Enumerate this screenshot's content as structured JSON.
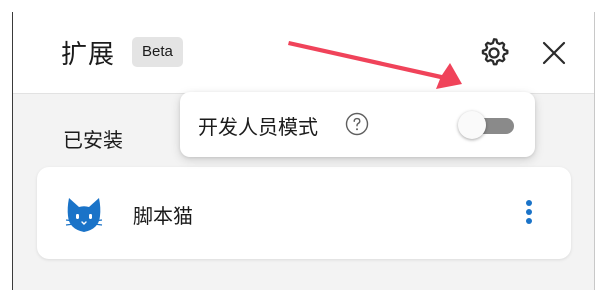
{
  "header": {
    "title": "扩展",
    "badge": "Beta",
    "settings_icon": "gear-icon",
    "close_icon": "close-icon"
  },
  "installed": {
    "section_title": "已安装",
    "extensions": [
      {
        "name": "脚本猫",
        "icon": "cat-icon",
        "icon_color": "#1a73c8",
        "menu_icon": "more-vertical-icon"
      }
    ]
  },
  "developer_popup": {
    "label": "开发人员模式",
    "help_icon": "help-circle-icon",
    "toggle_on": false
  },
  "annotation": {
    "arrow_color": "#f0435a"
  }
}
